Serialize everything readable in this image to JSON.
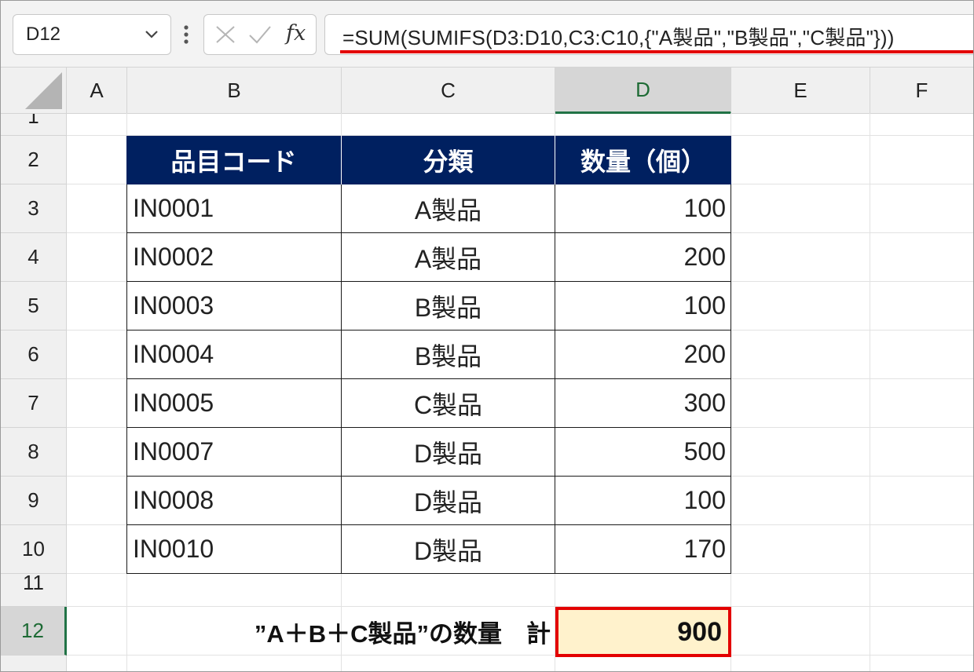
{
  "formula_bar": {
    "name_box": "D12",
    "fx_label": "fx",
    "formula": "=SUM(SUMIFS(D3:D10,C3:C10,{\"A製品\",\"B製品\",\"C製品\"}))"
  },
  "columns": [
    "A",
    "B",
    "C",
    "D",
    "E",
    "F"
  ],
  "rows": [
    "1",
    "2",
    "3",
    "4",
    "5",
    "6",
    "7",
    "8",
    "9",
    "10",
    "11",
    "12"
  ],
  "table": {
    "headers": [
      "品目コード",
      "分類",
      "数量（個）"
    ],
    "rows": [
      [
        "IN0001",
        "A製品",
        "100"
      ],
      [
        "IN0002",
        "A製品",
        "200"
      ],
      [
        "IN0003",
        "B製品",
        "100"
      ],
      [
        "IN0004",
        "B製品",
        "200"
      ],
      [
        "IN0005",
        "C製品",
        "300"
      ],
      [
        "IN0007",
        "D製品",
        "500"
      ],
      [
        "IN0008",
        "D製品",
        "100"
      ],
      [
        "IN0010",
        "D製品",
        "170"
      ]
    ]
  },
  "summary": {
    "label": "”A＋B＋C製品”の数量　計",
    "value": "900"
  },
  "colors": {
    "header_fill": "#002060",
    "highlight_fill": "#fff2cc",
    "highlight_border": "#e30000",
    "selection_green": "#217346"
  }
}
